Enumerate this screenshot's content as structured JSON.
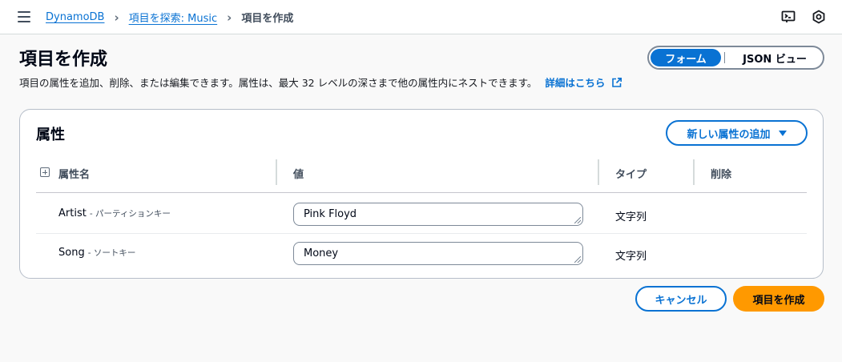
{
  "topbar": {
    "breadcrumbs": [
      {
        "label": "DynamoDB"
      },
      {
        "label": "項目を探索: Music"
      },
      {
        "label": "項目を作成"
      }
    ]
  },
  "header": {
    "title": "項目を作成",
    "description": "項目の属性を追加、削除、または編集できます。属性は、最大 32 レベルの深さまで他の属性内にネストできます。",
    "learn_more": "詳細はこちら",
    "view_toggle": {
      "form": "フォーム",
      "json": "JSON ビュー",
      "selected": "フォーム"
    }
  },
  "attributes": {
    "title": "属性",
    "add_button": "新しい属性の追加",
    "columns": {
      "name": "属性名",
      "value": "値",
      "type": "タイプ",
      "delete": "削除"
    },
    "rows": [
      {
        "name": "Artist",
        "hint": "- パーティションキー",
        "value": "Pink Floyd",
        "type": "文字列"
      },
      {
        "name": "Song",
        "hint": "- ソートキー",
        "value": "Money",
        "type": "文字列"
      }
    ]
  },
  "footer": {
    "cancel": "キャンセル",
    "create": "項目を作成"
  },
  "colors": {
    "accent": "#0972d3",
    "primary_button": "#ff9900"
  },
  "icons": [
    "menu-icon",
    "chevron-right-icon",
    "external-link-icon",
    "expand-icon",
    "caret-down-icon",
    "cloudshell-icon",
    "settings-icon"
  ]
}
